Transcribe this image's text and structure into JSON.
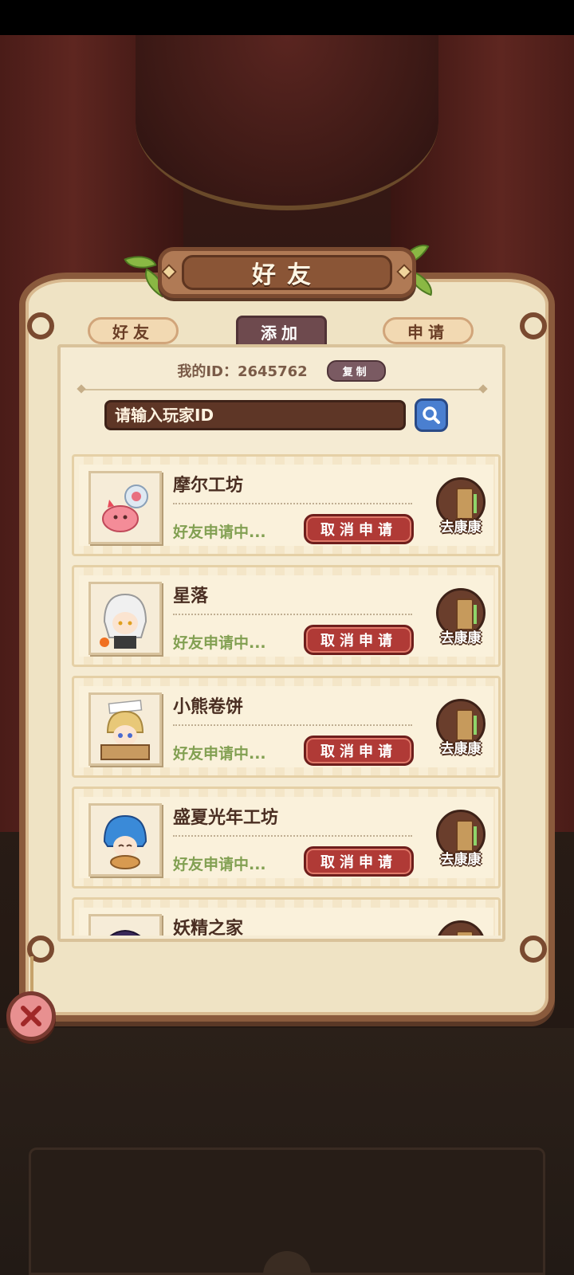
{
  "dialog": {
    "title": "好友"
  },
  "tabs": [
    {
      "label": "好友",
      "active": false
    },
    {
      "label": "添加",
      "active": true
    },
    {
      "label": "申请",
      "active": false
    }
  ],
  "my_id": {
    "text": "我的ID：2645762",
    "copy_label": "复制"
  },
  "search": {
    "placeholder": "请输入玩家ID",
    "value": ""
  },
  "requests": [
    {
      "name": "摩尔工坊",
      "status": "好友申请中...",
      "cancel_label": "取消申请",
      "visit_label": "去康康"
    },
    {
      "name": "星落",
      "status": "好友申请中...",
      "cancel_label": "取消申请",
      "visit_label": "去康康"
    },
    {
      "name": "小熊卷饼",
      "status": "好友申请中...",
      "cancel_label": "取消申请",
      "visit_label": "去康康"
    },
    {
      "name": "盛夏光年工坊",
      "status": "好友申请中...",
      "cancel_label": "取消申请",
      "visit_label": "去康康"
    },
    {
      "name": "妖精之家",
      "status": "",
      "cancel_label": "",
      "visit_label": ""
    }
  ],
  "colors": {
    "accent": "#b03a36",
    "status_green": "#82a052",
    "search_blue": "#4a7fd0"
  },
  "icons": {
    "search": "search-icon",
    "close": "close-icon",
    "visit": "door-icon"
  }
}
